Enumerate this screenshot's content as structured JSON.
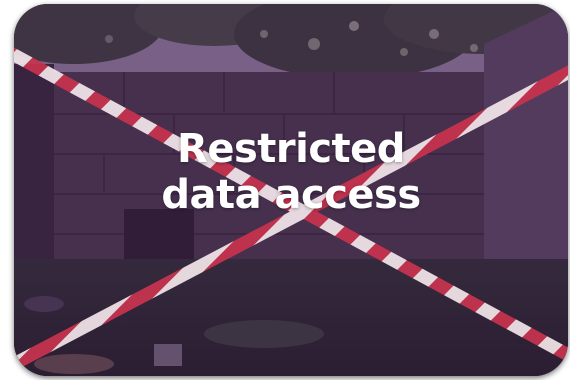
{
  "overlay": {
    "line1": "Restricted",
    "line2": "data access"
  },
  "icons": [
    "barrier-tape-cross"
  ],
  "colors": {
    "tint": "#5a2a6a",
    "tape_red": "#c8334e",
    "tape_white": "#f2e6ea",
    "text": "#ffffff"
  }
}
